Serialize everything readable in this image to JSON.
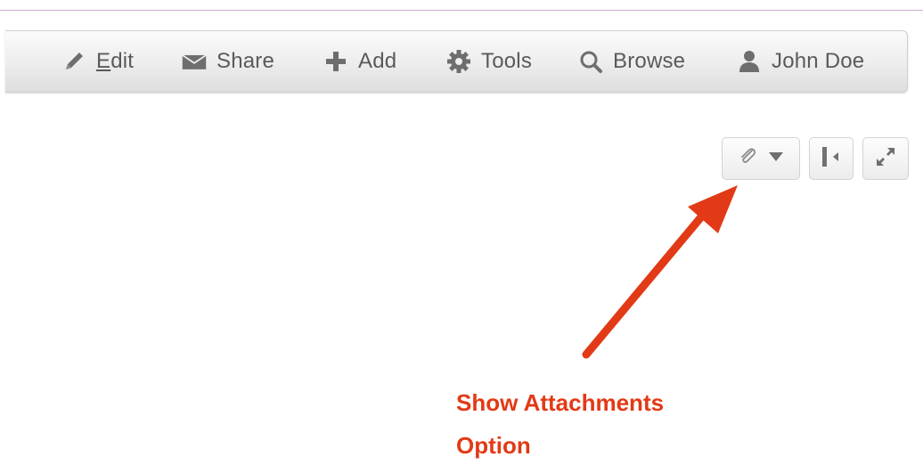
{
  "toolbar": {
    "items": [
      {
        "label": "Edit",
        "icon": "pencil-icon"
      },
      {
        "label": "Share",
        "icon": "envelope-icon"
      },
      {
        "label": "Add",
        "icon": "plus-icon"
      },
      {
        "label": "Tools",
        "icon": "gear-icon"
      },
      {
        "label": "Browse",
        "icon": "search-icon"
      },
      {
        "label": "John Doe",
        "icon": "user-icon"
      }
    ]
  },
  "panel_controls": [
    {
      "name": "attachments",
      "icons": [
        "paperclip-icon",
        "caret-down-icon"
      ]
    },
    {
      "name": "collapse-panel",
      "icons": [
        "collapse-left-icon"
      ]
    },
    {
      "name": "expand-panel",
      "icons": [
        "expand-icon"
      ]
    }
  ],
  "annotation": {
    "line1": "Show Attachments",
    "line2": "Option",
    "color": "#e23a16"
  },
  "colors": {
    "toolbar_text": "#5a5a5a",
    "icon_gray": "#6e6e6e",
    "divider": "#c9a8cf"
  }
}
